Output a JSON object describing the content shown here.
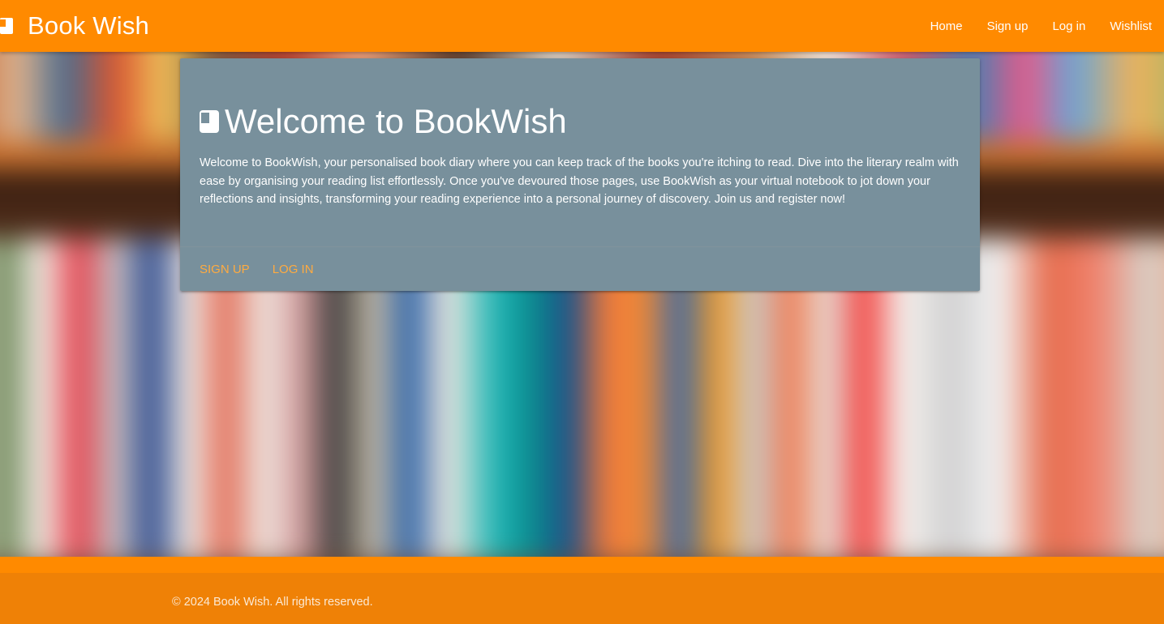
{
  "navbar": {
    "brand": "Book Wish",
    "brand_icon": "book-icon",
    "links": [
      "Home",
      "Sign up",
      "Log in",
      "Wishlist"
    ]
  },
  "card": {
    "title": "Welcome to BookWish",
    "title_icon": "book-icon",
    "text": "Welcome to BookWish, your personalised book diary where you can keep track of the books you're itching to read. Dive into the literary realm with ease by organising your reading list effortlessly. Once you've devoured those pages, use BookWish as your virtual notebook to jot down your reflections and insights, transforming your reading experience into a personal journey of discovery. Join us and register now!",
    "actions": [
      "Sign up",
      "Log in"
    ]
  },
  "footer": {
    "text": "© 2024 Book Wish. All rights reserved."
  },
  "colors": {
    "navbar": "#ff8a00",
    "footer": "#ef8106",
    "card": "#78909c",
    "action_link": "#ffab40"
  }
}
